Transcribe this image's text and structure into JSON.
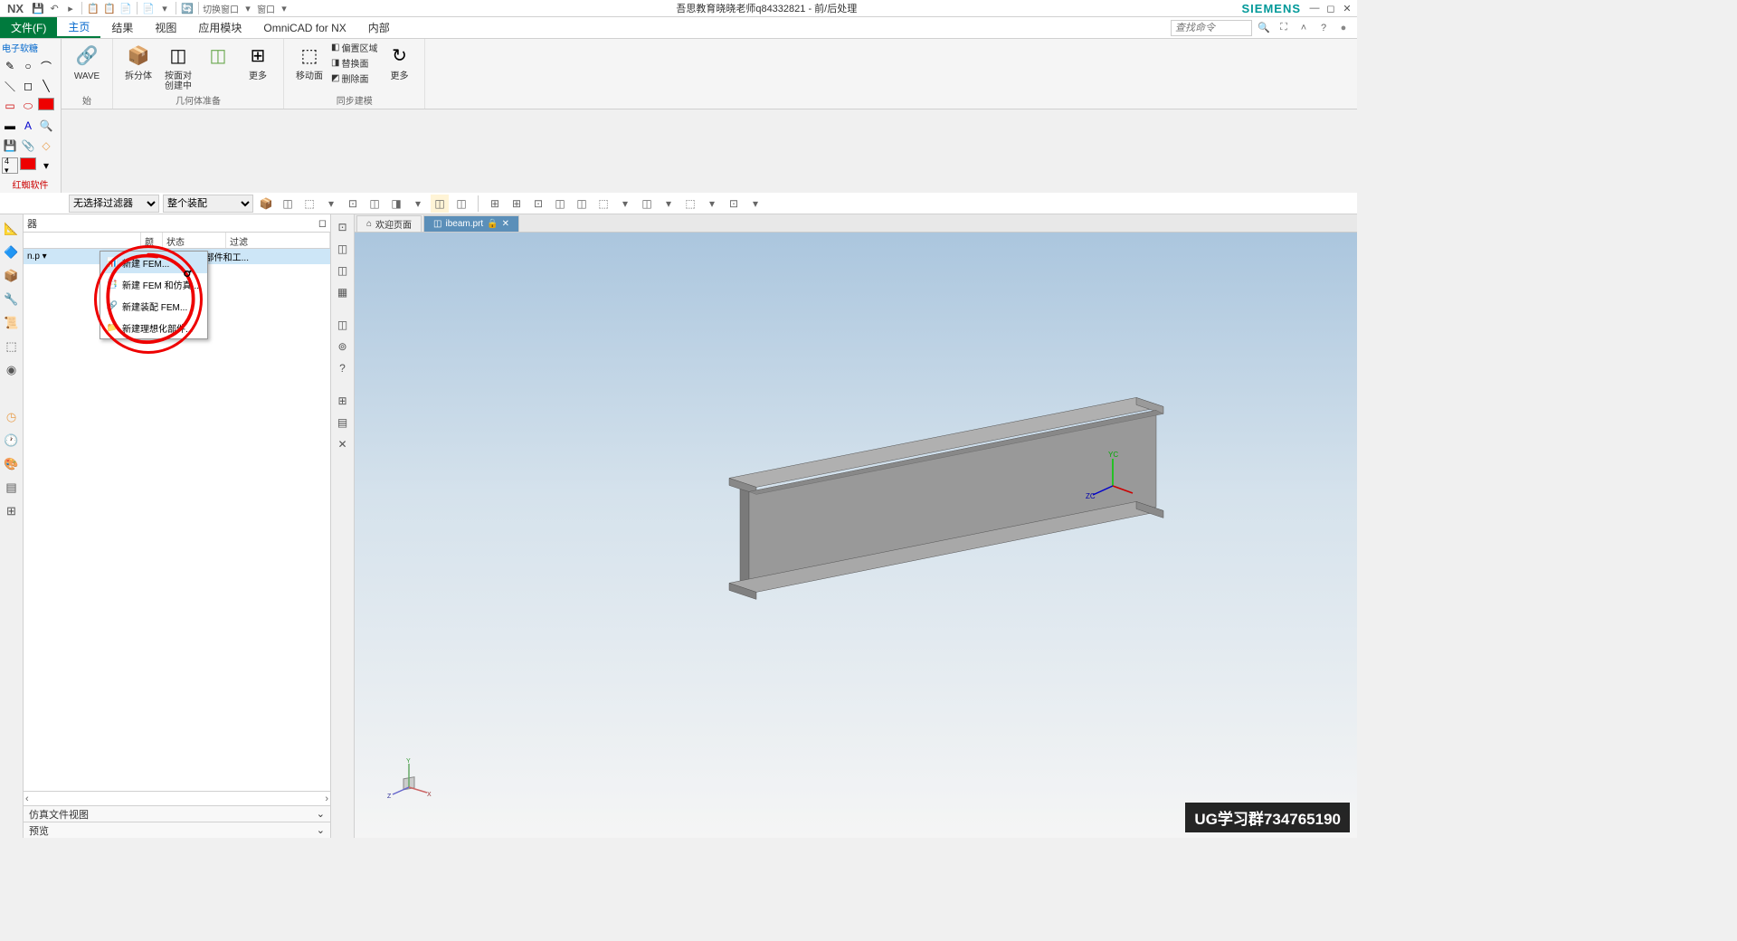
{
  "titlebar": {
    "logo": "NX",
    "qat_items": [
      "💾",
      "↶",
      "▸",
      "📋",
      "📋",
      "📄",
      "▸",
      "📄",
      "▾",
      "🔄",
      "切换窗口",
      "▾",
      "窗口",
      "▾"
    ],
    "title": "吾思教育晓晓老师q84332821 - 前/后处理",
    "brand": "SIEMENS"
  },
  "menubar": {
    "file": "文件(F)",
    "tabs": [
      "主页",
      "结果",
      "视图",
      "应用模块",
      "OmniCAD for NX",
      "内部"
    ],
    "active_tab": 0,
    "search_placeholder": "查找命令"
  },
  "ribbon": {
    "left_label_top": "电子软糖",
    "left_label_bottom": "红蜘软件",
    "groups": [
      {
        "name": "始",
        "buttons": [
          {
            "label": "WAVE",
            "icon": "🔗",
            "color": "#0066cc"
          }
        ]
      },
      {
        "name": "几何体准备",
        "buttons": [
          {
            "label": "拆分体",
            "icon": "📦",
            "color": "#e8a050"
          },
          {
            "label": "按面对\n创建中",
            "icon": "◫",
            "color": "#888"
          },
          {
            "label": "◫",
            "icon": "◫",
            "color": "#6aa84f"
          },
          {
            "label": "更多",
            "icon": "⊞",
            "color": "#888"
          }
        ]
      },
      {
        "name": "同步建模",
        "buttons": [
          {
            "label": "移动面",
            "icon": "⬚",
            "color": "#888"
          }
        ],
        "small": [
          "偏置区域",
          "替换面",
          "删除面"
        ],
        "more": "更多"
      }
    ]
  },
  "filterbar": {
    "sel1": "无选择过滤器",
    "sel2": "整个装配"
  },
  "navpanel": {
    "header": "器",
    "cols": {
      "c1": "",
      "c2": "颜",
      "c3": "状态",
      "c4": "过滤"
    },
    "row1_status": "显示部件和工...",
    "row1_name": "n.p ▾",
    "ctxmenu": [
      {
        "icon": "📊",
        "label": "新建 FEM...",
        "hover": true
      },
      {
        "icon": "📑",
        "label": "新建 FEM 和仿真..."
      },
      {
        "icon": "🔗",
        "label": "新建装配 FEM..."
      },
      {
        "icon": "📁",
        "label": "新建理想化部件..."
      }
    ],
    "accordion1": "仿真文件视图",
    "accordion2": "预览"
  },
  "viewport": {
    "tab1": "欢迎页面",
    "tab2": "ibeam.prt",
    "triad": {
      "x": "X",
      "y": "Y",
      "z": "Z"
    },
    "wcs": {
      "yc": "YC",
      "zc": "ZC"
    },
    "watermark": "UG学习群734765190"
  }
}
